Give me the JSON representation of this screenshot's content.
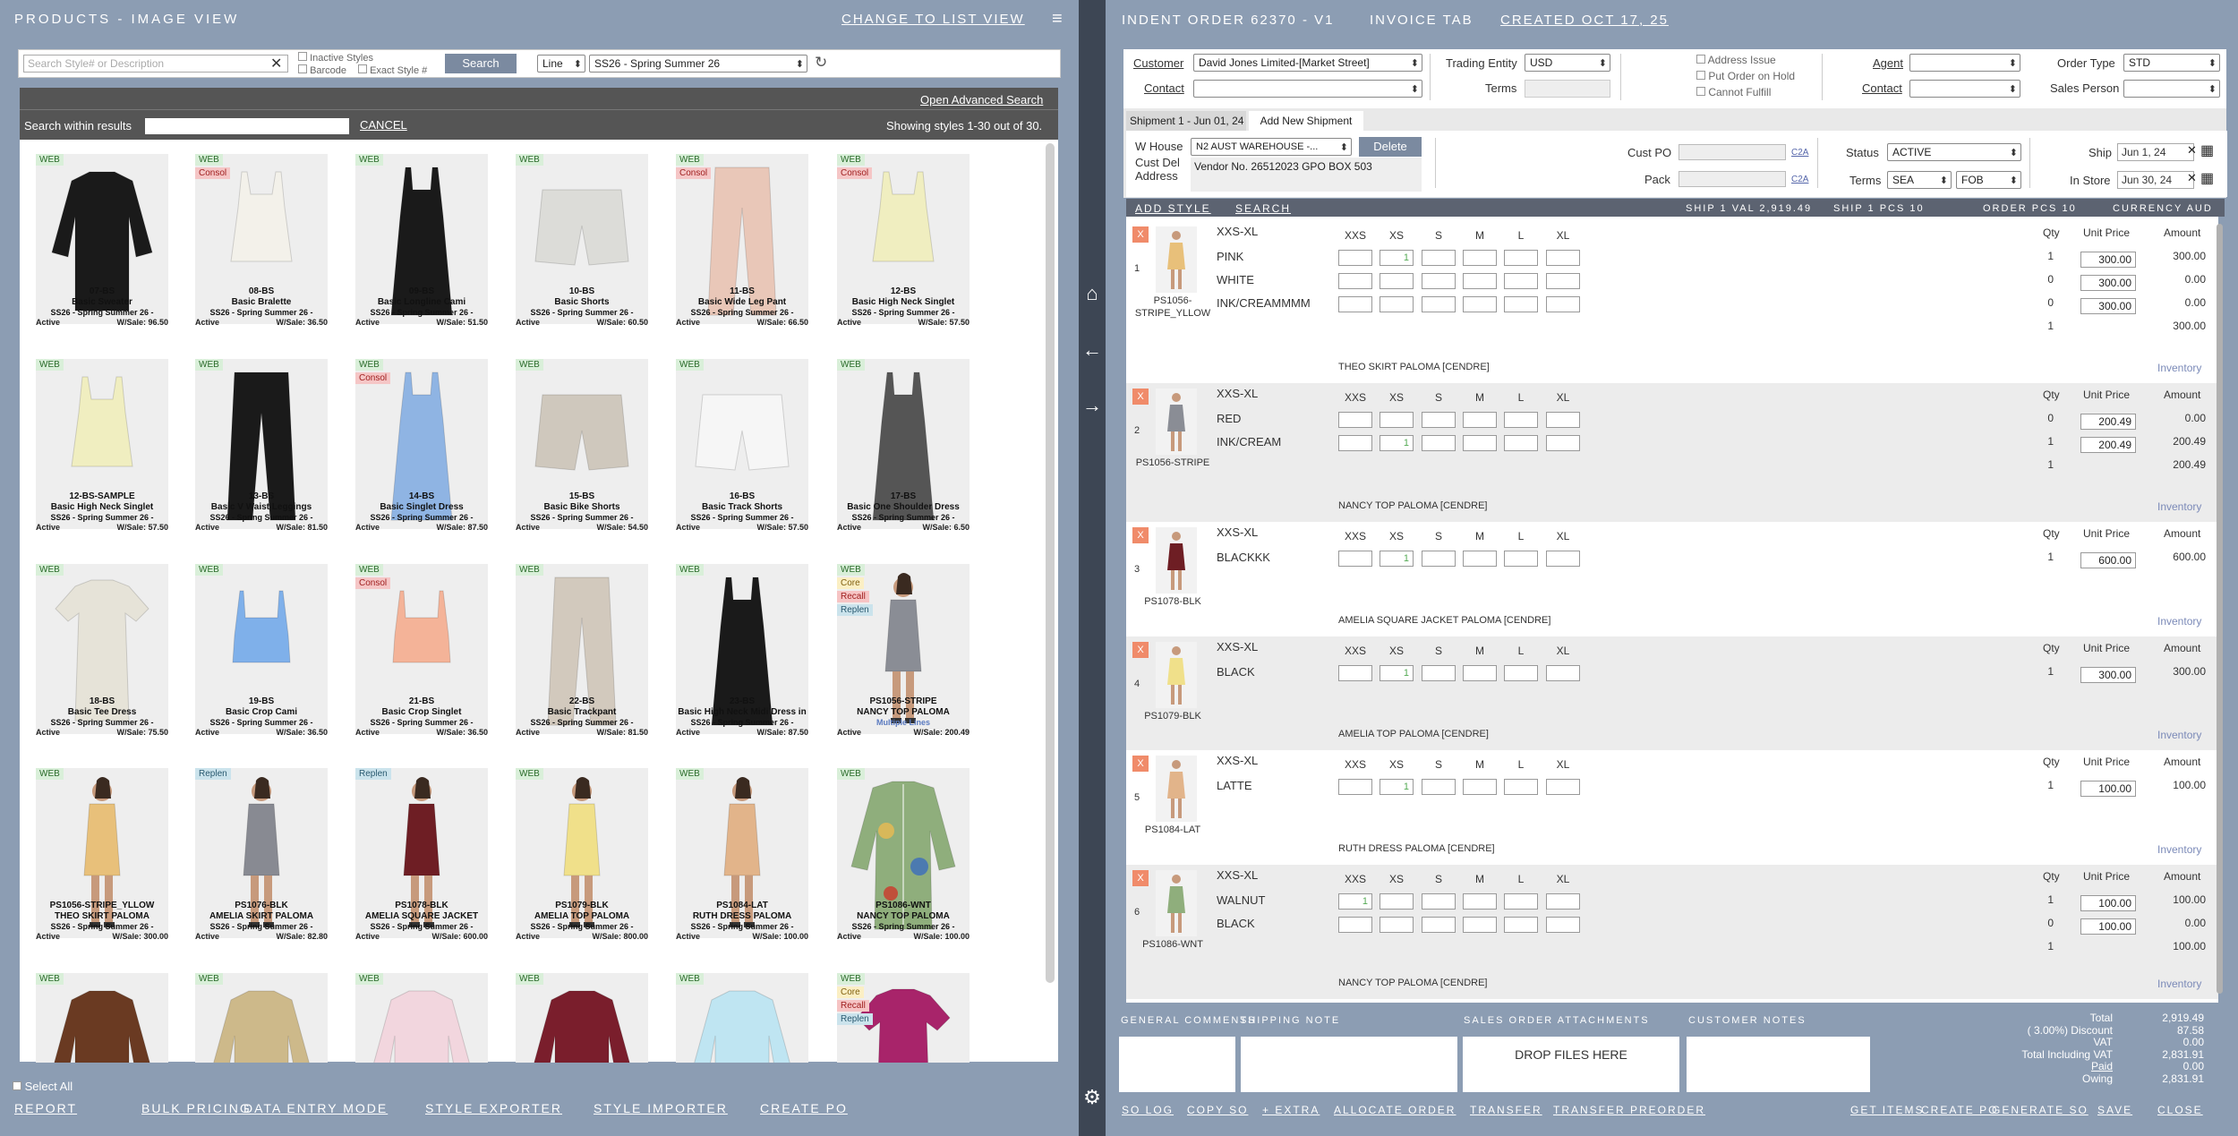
{
  "left": {
    "title": "PRODUCTS - IMAGE VIEW",
    "change_view": "CHANGE TO LIST VIEW",
    "search_placeholder": "Search Style# or Description",
    "inactive_styles": "Inactive Styles",
    "barcode": "Barcode",
    "exact_style": "Exact Style #",
    "search_button": "Search",
    "line_select": "Line",
    "season_select": "SS26 - Spring Summer 26",
    "open_advanced": "Open Advanced Search",
    "search_within": "Search within results",
    "cancel": "CANCEL",
    "showing": "Showing styles 1-30 out of 30.",
    "select_all": "Select All",
    "bottom_links": [
      "REPORT",
      "BULK PRICING",
      "DATA ENTRY MODE",
      "STYLE EXPORTER",
      "STYLE IMPORTER",
      "CREATE PO"
    ]
  },
  "products": [
    {
      "badges": [
        "WEB"
      ],
      "code": "07-BS",
      "name": "Basic Sweater",
      "season": "SS26 - Spring Summer 26 -",
      "status": "Active",
      "ws": "W/Sale: 96.50",
      "color": "#1a1a1a",
      "shape": "sweater"
    },
    {
      "badges": [
        "WEB",
        "Consol"
      ],
      "code": "08-BS",
      "name": "Basic Bralette",
      "season": "SS26 - Spring Summer 26 -",
      "status": "Active",
      "ws": "W/Sale: 36.50",
      "color": "#f3f1ea",
      "shape": "tank"
    },
    {
      "badges": [
        "WEB"
      ],
      "code": "09-BS",
      "name": "Basic Longline Cami",
      "season": "SS26 - Spring Summer 26 -",
      "status": "Active",
      "ws": "W/Sale: 51.50",
      "color": "#1a1a1a",
      "shape": "dress"
    },
    {
      "badges": [
        "WEB"
      ],
      "code": "10-BS",
      "name": "Basic Shorts",
      "season": "SS26 - Spring Summer 26 -",
      "status": "Active",
      "ws": "W/Sale: 60.50",
      "color": "#dcdcd8",
      "shape": "shorts"
    },
    {
      "badges": [
        "WEB",
        "Consol"
      ],
      "code": "11-BS",
      "name": "Basic Wide Leg Pant",
      "season": "SS26 - Spring Summer 26 -",
      "status": "Active",
      "ws": "W/Sale: 66.50",
      "color": "#e9c7b8",
      "shape": "pants"
    },
    {
      "badges": [
        "WEB",
        "Consol"
      ],
      "code": "12-BS",
      "name": "Basic High Neck Singlet",
      "season": "SS26 - Spring Summer 26 -",
      "status": "Active",
      "ws": "W/Sale: 57.50",
      "color": "#f0eec0",
      "shape": "tank"
    },
    {
      "badges": [
        "WEB"
      ],
      "code": "12-BS-SAMPLE",
      "name": "Basic High Neck Singlet",
      "season": "SS26 - Spring Summer 26 -",
      "status": "Active",
      "ws": "W/Sale: 57.50",
      "color": "#f0eec0",
      "shape": "tank"
    },
    {
      "badges": [
        "WEB"
      ],
      "code": "13-BS",
      "name": "Basic V Waist Leggings",
      "season": "SS26 - Spring Summer 26 -",
      "status": "Active",
      "ws": "W/Sale: 81.50",
      "color": "#1a1a1a",
      "shape": "pants"
    },
    {
      "badges": [
        "WEB",
        "Consol"
      ],
      "code": "14-BS",
      "name": "Basic Singlet Dress",
      "season": "SS26 - Spring Summer 26 -",
      "status": "Active",
      "ws": "W/Sale: 87.50",
      "color": "#8fb4e3",
      "shape": "dress"
    },
    {
      "badges": [
        "WEB"
      ],
      "code": "15-BS",
      "name": "Basic Bike Shorts",
      "season": "SS26 - Spring Summer 26 -",
      "status": "Active",
      "ws": "W/Sale: 54.50",
      "color": "#cfc8bd",
      "shape": "shorts"
    },
    {
      "badges": [
        "WEB"
      ],
      "code": "16-BS",
      "name": "Basic Track Shorts",
      "season": "SS26 - Spring Summer 26 -",
      "status": "Active",
      "ws": "W/Sale: 57.50",
      "color": "#f6f6f6",
      "shape": "shorts"
    },
    {
      "badges": [
        "WEB"
      ],
      "code": "17-BS",
      "name": "Basic One Shoulder Dress",
      "season": "SS26 - Spring Summer 26 -",
      "status": "Active",
      "ws": "W/Sale: 6.50",
      "color": "#555555",
      "shape": "dress"
    },
    {
      "badges": [
        "WEB"
      ],
      "code": "18-BS",
      "name": "Basic Tee Dress",
      "season": "SS26 - Spring Summer 26 -",
      "status": "Active",
      "ws": "W/Sale: 75.50",
      "color": "#e6e3d8",
      "shape": "tee"
    },
    {
      "badges": [
        "WEB"
      ],
      "code": "19-BS",
      "name": "Basic Crop Cami",
      "season": "SS26 - Spring Summer 26 -",
      "status": "Active",
      "ws": "W/Sale: 36.50",
      "color": "#7fb0ea",
      "shape": "crop"
    },
    {
      "badges": [
        "WEB",
        "Consol"
      ],
      "code": "21-BS",
      "name": "Basic Crop Singlet",
      "season": "SS26 - Spring Summer 26 -",
      "status": "Active",
      "ws": "W/Sale: 36.50",
      "color": "#f4b398",
      "shape": "crop"
    },
    {
      "badges": [
        "WEB"
      ],
      "code": "22-BS",
      "name": "Basic Trackpant",
      "season": "SS26 - Spring Summer 26 -",
      "status": "Active",
      "ws": "W/Sale: 81.50",
      "color": "#d2c9bd",
      "shape": "pants"
    },
    {
      "badges": [
        "WEB"
      ],
      "code": "23-BS",
      "name": "Basic High Neck Midi Dress in",
      "season": "SS26 - Spring Summer 26 -",
      "status": "Active",
      "ws": "W/Sale: 87.50",
      "color": "#1a1a1a",
      "shape": "dress"
    },
    {
      "badges": [
        "WEB",
        "Core",
        "Recall",
        "Replen"
      ],
      "code": "PS1056-STRIPE",
      "name": "NANCY TOP PALOMA",
      "season": "Multiple Lines",
      "status": "Active",
      "ws": "W/Sale: 200.49",
      "color": "#8a8d95",
      "shape": "model"
    },
    {
      "badges": [
        "WEB"
      ],
      "code": "PS1056-STRIPE_YLLOW",
      "name": "THEO SKIRT PALOMA",
      "season": "SS26 - Spring Summer 26 -",
      "status": "Active",
      "ws": "W/Sale: 300.00",
      "color": "#e8c07a",
      "shape": "model"
    },
    {
      "badges": [
        "Replen"
      ],
      "code": "PS1076-BLK",
      "name": "AMELIA SKIRT PALOMA",
      "season": "SS26 - Spring Summer 26 -",
      "status": "Active",
      "ws": "W/Sale: 82.80",
      "color": "#888a92",
      "shape": "model"
    },
    {
      "badges": [
        "Replen"
      ],
      "code": "PS1078-BLK",
      "name": "AMELIA SQUARE JACKET",
      "season": "SS26 - Spring Summer 26 -",
      "status": "Active",
      "ws": "W/Sale: 600.00",
      "color": "#6e1e24",
      "shape": "model"
    },
    {
      "badges": [
        "WEB"
      ],
      "code": "PS1079-BLK",
      "name": "AMELIA TOP PALOMA",
      "season": "SS26 - Spring Summer 26 -",
      "status": "Active",
      "ws": "W/Sale: 800.00",
      "color": "#f0e08a",
      "shape": "model"
    },
    {
      "badges": [
        "WEB"
      ],
      "code": "PS1084-LAT",
      "name": "RUTH DRESS PALOMA",
      "season": "SS26 - Spring Summer 26 -",
      "status": "Active",
      "ws": "W/Sale: 100.00",
      "color": "#e2b48a",
      "shape": "model"
    },
    {
      "badges": [
        "WEB"
      ],
      "code": "PS1086-WNT",
      "name": "NANCY TOP PALOMA",
      "season": "SS26 - Spring Summer 26 -",
      "status": "Active",
      "ws": "W/Sale: 100.00",
      "color": "#8fae7c",
      "shape": "shirt"
    },
    {
      "badges": [
        "WEB"
      ],
      "code": "",
      "name": "",
      "season": "",
      "status": "",
      "ws": "",
      "color": "#6a3a22",
      "shape": "sweater"
    },
    {
      "badges": [
        "WEB"
      ],
      "code": "",
      "name": "",
      "season": "",
      "status": "",
      "ws": "",
      "color": "#cdb98a",
      "shape": "sweater"
    },
    {
      "badges": [
        "WEB"
      ],
      "code": "",
      "name": "",
      "season": "",
      "status": "",
      "ws": "",
      "color": "#f2d6de",
      "shape": "sweater"
    },
    {
      "badges": [
        "WEB"
      ],
      "code": "",
      "name": "",
      "season": "",
      "status": "",
      "ws": "",
      "color": "#7a1e2c",
      "shape": "sweater"
    },
    {
      "badges": [
        "WEB"
      ],
      "code": "",
      "name": "",
      "season": "",
      "status": "",
      "ws": "",
      "color": "#bfe5f2",
      "shape": "sweater"
    },
    {
      "badges": [
        "WEB",
        "Core",
        "Recall",
        "Replen"
      ],
      "code": "",
      "name": "",
      "season": "",
      "status": "",
      "ws": "",
      "color": "#a8246a",
      "shape": "tee"
    }
  ],
  "right": {
    "title": "INDENT ORDER 62370 - V1",
    "tab": "INVOICE TAB",
    "created": "CREATED OCT 17, 25",
    "customer_label": "Customer",
    "customer_value": "David Jones Limited-[Market Street]",
    "contact_label": "Contact",
    "trading_entity_label": "Trading Entity",
    "trading_entity_value": "USD",
    "terms_label": "Terms",
    "address_issue": "Address Issue",
    "put_on_hold": "Put Order on Hold",
    "cannot_fulfill": "Cannot Fulfill",
    "agent_label": "Agent",
    "contact2_label": "Contact",
    "order_type_label": "Order Type",
    "order_type_value": "STD",
    "sales_person_label": "Sales Person",
    "shipment_tab": "Shipment 1 - Jun 01, 24",
    "add_shipment_tab": "Add New Shipment",
    "warehouse_label": "W House",
    "warehouse_value": "N2 AUST WAREHOUSE -...",
    "delete": "Delete",
    "cust_del_label": "Cust Del Address",
    "cust_del_value": "Vendor No. 26512023 GPO BOX  503",
    "cust_po_label": "Cust PO",
    "pack_label": "Pack",
    "c2a": "C2A",
    "status_label": "Status",
    "status_value": "ACTIVE",
    "terms2_label": "Terms",
    "terms_sea": "SEA",
    "terms_fob": "FOB",
    "ship_label": "Ship",
    "ship_value": "Jun 1, 24",
    "instore_label": "In Store",
    "instore_value": "Jun 30, 24",
    "add_style": "ADD STYLE",
    "search": "SEARCH",
    "ship1_val": "SHIP 1 VAL 2,919.49",
    "ship1_pcs": "SHIP 1 PCS 10",
    "order_pcs": "ORDER PCS 10",
    "currency": "CURRENCY AUD",
    "size_headers": [
      "XXS",
      "XS",
      "S",
      "M",
      "L",
      "XL"
    ],
    "qty_label": "Qty",
    "unit_price_label": "Unit Price",
    "amount_label": "Amount",
    "inventory": "Inventory",
    "x": "X"
  },
  "order_lines": [
    {
      "no": "1",
      "code": "PS1056-STRIPE_YLLOW",
      "range": "XXS-XL",
      "desc": "THEO SKIRT PALOMA [CENDRE]",
      "img": "#e8c07a",
      "shade": false,
      "rows": [
        {
          "color": "PINK",
          "xs": "1",
          "qty": "1",
          "price": "300.00",
          "amount": "300.00"
        },
        {
          "color": "WHITE",
          "xs": "",
          "qty": "0",
          "price": "300.00",
          "amount": "0.00"
        },
        {
          "color": "INK/CREAMMMM",
          "xs": "",
          "qty": "0",
          "price": "300.00",
          "amount": "0.00"
        }
      ],
      "total_qty": "1",
      "total_amount": "300.00"
    },
    {
      "no": "2",
      "code": "PS1056-STRIPE",
      "range": "XXS-XL",
      "desc": "NANCY TOP PALOMA [CENDRE]",
      "img": "#8a8d95",
      "shade": true,
      "rows": [
        {
          "color": "RED",
          "xs": "",
          "qty": "0",
          "price": "200.49",
          "amount": "0.00"
        },
        {
          "color": "INK/CREAM",
          "xs": "1",
          "qty": "1",
          "price": "200.49",
          "amount": "200.49"
        }
      ],
      "total_qty": "1",
      "total_amount": "200.49"
    },
    {
      "no": "3",
      "code": "PS1078-BLK",
      "range": "XXS-XL",
      "desc": "AMELIA SQUARE JACKET PALOMA [CENDRE]",
      "img": "#6e1e24",
      "shade": false,
      "rows": [
        {
          "color": "BLACKKK",
          "xs": "1",
          "qty": "1",
          "price": "600.00",
          "amount": "600.00"
        }
      ],
      "total_qty": "",
      "total_amount": ""
    },
    {
      "no": "4",
      "code": "PS1079-BLK",
      "range": "XXS-XL",
      "desc": "AMELIA TOP PALOMA [CENDRE]",
      "img": "#f0e08a",
      "shade": true,
      "rows": [
        {
          "color": "BLACK",
          "xs": "1",
          "qty": "1",
          "price": "300.00",
          "amount": "300.00"
        }
      ],
      "total_qty": "",
      "total_amount": ""
    },
    {
      "no": "5",
      "code": "PS1084-LAT",
      "range": "XXS-XL",
      "desc": "RUTH DRESS PALOMA [CENDRE]",
      "img": "#e2b48a",
      "shade": false,
      "rows": [
        {
          "color": "LATTE",
          "xs": "1",
          "qty": "1",
          "price": "100.00",
          "amount": "100.00"
        }
      ],
      "total_qty": "",
      "total_amount": ""
    },
    {
      "no": "6",
      "code": "PS1086-WNT",
      "range": "XXS-XL",
      "desc": "NANCY TOP PALOMA [CENDRE]",
      "img": "#8fae7c",
      "shade": true,
      "rows": [
        {
          "color": "WALNUT",
          "xxs": "1",
          "xs": "",
          "qty": "1",
          "price": "100.00",
          "amount": "100.00"
        },
        {
          "color": "BLACK",
          "xs": "",
          "qty": "0",
          "price": "100.00",
          "amount": "0.00"
        }
      ],
      "total_qty": "1",
      "total_amount": "100.00"
    }
  ],
  "footer": {
    "general_comments": "GENERAL COMMENTS",
    "shipping_note": "SHIPPING NOTE",
    "attachments": "SALES ORDER ATTACHMENTS",
    "drop_files": "DROP FILES HERE",
    "customer_notes": "CUSTOMER NOTES",
    "totals": [
      {
        "label": "Total",
        "value": "2,919.49"
      },
      {
        "label": "( 3.00%) Discount",
        "value": "87.58"
      },
      {
        "label": "VAT",
        "value": "0.00"
      },
      {
        "label": "Total Including VAT",
        "value": "2,831.91"
      },
      {
        "label": "Paid",
        "value": "0.00"
      },
      {
        "label": "Owing",
        "value": "2,831.91"
      }
    ],
    "links_left": [
      "SO LOG",
      "COPY SO",
      "+ EXTRA",
      "ALLOCATE ORDER",
      "TRANSFER",
      "TRANSFER PREORDER"
    ],
    "links_right": [
      "GET ITEMS",
      "CREATE PO",
      "GENERATE SO",
      "SAVE",
      "CLOSE"
    ]
  }
}
